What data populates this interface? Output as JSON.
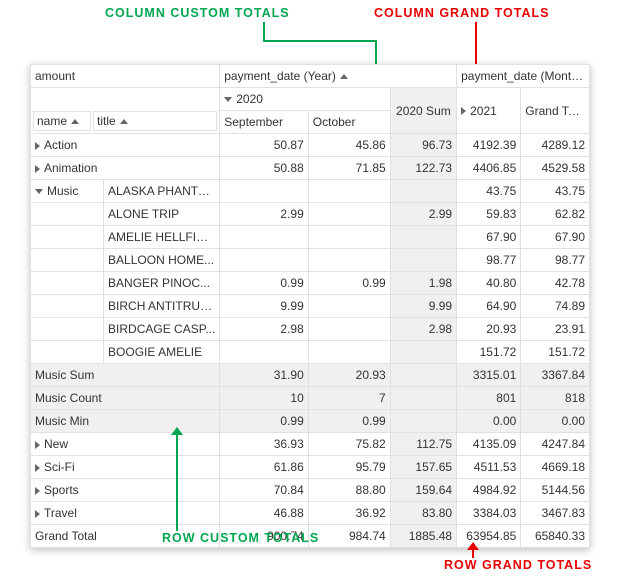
{
  "labels": {
    "col_custom": "COLUMN CUSTOM TOTALS",
    "col_grand": "COLUMN GRAND TOTALS",
    "row_custom": "ROW CUSTOM TOTALS",
    "row_grand": "ROW GRAND TOTALS"
  },
  "headers": {
    "amount": "amount",
    "name": "name",
    "title": "title",
    "payment_year": "payment_date (Year)",
    "payment_month": "payment_date (Month)",
    "y2020": "2020",
    "sept": "September",
    "oct": "October",
    "sum2020": "2020 Sum",
    "y2021": "2021",
    "grand": "Grand Total"
  },
  "rows": [
    {
      "kind": "cat",
      "exp": false,
      "name": "Action",
      "vals": [
        "50.87",
        "45.86",
        "96.73",
        "4192.39",
        "4289.12"
      ]
    },
    {
      "kind": "cat",
      "exp": false,
      "name": "Animation",
      "vals": [
        "50.88",
        "71.85",
        "122.73",
        "4406.85",
        "4529.58"
      ]
    },
    {
      "kind": "cat",
      "exp": true,
      "name": "Music",
      "title": "ALASKA PHANTOM",
      "vals": [
        "",
        "",
        "",
        "43.75",
        "43.75"
      ]
    },
    {
      "kind": "sub",
      "title": "ALONE TRIP",
      "vals": [
        "2.99",
        "",
        "2.99",
        "59.83",
        "62.82"
      ]
    },
    {
      "kind": "sub",
      "title": "AMELIE HELLFIG...",
      "vals": [
        "",
        "",
        "",
        "67.90",
        "67.90"
      ]
    },
    {
      "kind": "sub",
      "title": "BALLOON HOME...",
      "vals": [
        "",
        "",
        "",
        "98.77",
        "98.77"
      ]
    },
    {
      "kind": "sub",
      "title": "BANGER PINOC...",
      "vals": [
        "0.99",
        "0.99",
        "1.98",
        "40.80",
        "42.78"
      ]
    },
    {
      "kind": "sub",
      "title": "BIRCH ANTITRUST",
      "vals": [
        "9.99",
        "",
        "9.99",
        "64.90",
        "74.89"
      ]
    },
    {
      "kind": "sub",
      "title": "BIRDCAGE CASP...",
      "vals": [
        "2.98",
        "",
        "2.98",
        "20.93",
        "23.91"
      ]
    },
    {
      "kind": "sub",
      "title": "BOOGIE AMELIE",
      "vals": [
        "",
        "",
        "",
        "151.72",
        "151.72"
      ]
    },
    {
      "kind": "agg",
      "name": "Music Sum",
      "vals": [
        "31.90",
        "20.93",
        "",
        "3315.01",
        "3367.84"
      ]
    },
    {
      "kind": "agg",
      "name": "Music Count",
      "vals": [
        "10",
        "7",
        "",
        "801",
        "818"
      ]
    },
    {
      "kind": "agg",
      "name": "Music Min",
      "vals": [
        "0.99",
        "0.99",
        "",
        "0.00",
        "0.00"
      ]
    },
    {
      "kind": "cat",
      "exp": false,
      "name": "New",
      "vals": [
        "36.93",
        "75.82",
        "112.75",
        "4135.09",
        "4247.84"
      ]
    },
    {
      "kind": "cat",
      "exp": false,
      "name": "Sci-Fi",
      "vals": [
        "61.86",
        "95.79",
        "157.65",
        "4511.53",
        "4669.18"
      ]
    },
    {
      "kind": "cat",
      "exp": false,
      "name": "Sports",
      "vals": [
        "70.84",
        "88.80",
        "159.64",
        "4984.92",
        "5144.56"
      ]
    },
    {
      "kind": "cat",
      "exp": false,
      "name": "Travel",
      "vals": [
        "46.88",
        "36.92",
        "83.80",
        "3384.03",
        "3467.83"
      ]
    },
    {
      "kind": "grand",
      "name": "Grand Total",
      "vals": [
        "900.74",
        "984.74",
        "1885.48",
        "63954.85",
        "65840.33"
      ]
    }
  ]
}
